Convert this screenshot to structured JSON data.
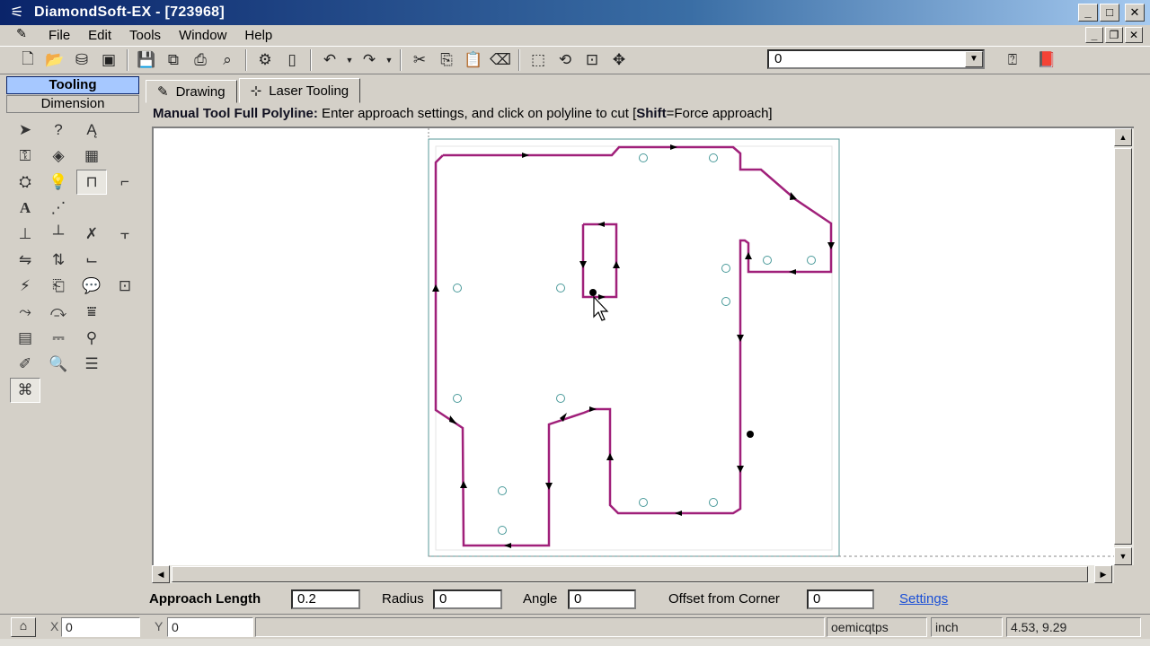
{
  "window": {
    "title": "DiamondSoft-EX - [723968]",
    "logo": "DS-logo"
  },
  "menu": {
    "items": [
      "File",
      "Edit",
      "Tools",
      "Window",
      "Help"
    ]
  },
  "toolbar": {
    "layer_value": "0"
  },
  "left_panel": {
    "tabs": {
      "tooling": "Tooling",
      "dimension": "Dimension"
    }
  },
  "doc_tabs": {
    "drawing": "Drawing",
    "laser_tooling": "Laser Tooling"
  },
  "hint": {
    "bold_prefix": "Manual Tool Full Polyline:",
    "text": " Enter approach settings, and click on polyline to cut [",
    "shift": "Shift",
    "suffix": "=Force approach]"
  },
  "params": {
    "approach_length_label": "Approach Length",
    "approach_length_value": "0.2",
    "radius_label": "Radius",
    "radius_value": "0",
    "angle_label": "Angle",
    "angle_value": "0",
    "offset_label": "Offset from Corner",
    "offset_value": "0",
    "settings_link": "Settings"
  },
  "statusbar": {
    "x_label": "X",
    "x_value": "0",
    "y_label": "Y",
    "y_value": "0",
    "code": "oemicqtps",
    "unit": "inch",
    "coords": "4.53, 9.29"
  },
  "colors": {
    "cut_path": "#a0207a",
    "circle": "#4a9a9a",
    "accent": "#0a246a"
  }
}
